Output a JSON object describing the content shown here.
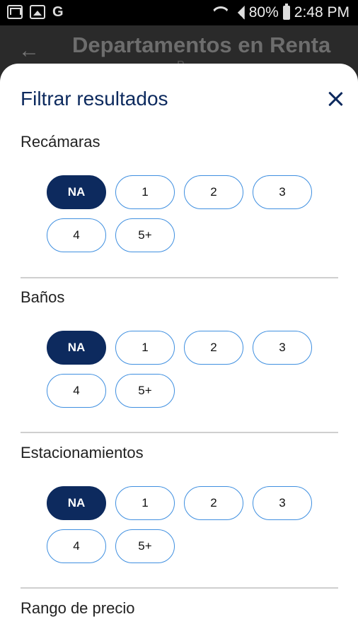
{
  "status_bar": {
    "battery_percent": "80%",
    "time": "2:48 PM",
    "left_icons": [
      "mail-icon",
      "image-icon",
      "google-g-icon"
    ],
    "right_icons": [
      "wifi-icon",
      "signal-icon",
      "battery-icon"
    ],
    "g_label": "G"
  },
  "app_bar": {
    "title": "Departamentos en Renta",
    "subtitle": "P..."
  },
  "sheet": {
    "title": "Filtrar resultados",
    "sections": [
      {
        "label": "Recámaras",
        "options": [
          "NA",
          "1",
          "2",
          "3",
          "4",
          "5+"
        ],
        "selected": "NA"
      },
      {
        "label": "Baños",
        "options": [
          "NA",
          "1",
          "2",
          "3",
          "4",
          "5+"
        ],
        "selected": "NA"
      },
      {
        "label": "Estacionamientos",
        "options": [
          "NA",
          "1",
          "2",
          "3",
          "4",
          "5+"
        ],
        "selected": "NA"
      },
      {
        "label": "Rango de precio",
        "options": [],
        "selected": ""
      }
    ]
  },
  "colors": {
    "accent": "#0d2a5e",
    "chip_border": "#3f8fe0",
    "divider": "#cfcfcf"
  }
}
